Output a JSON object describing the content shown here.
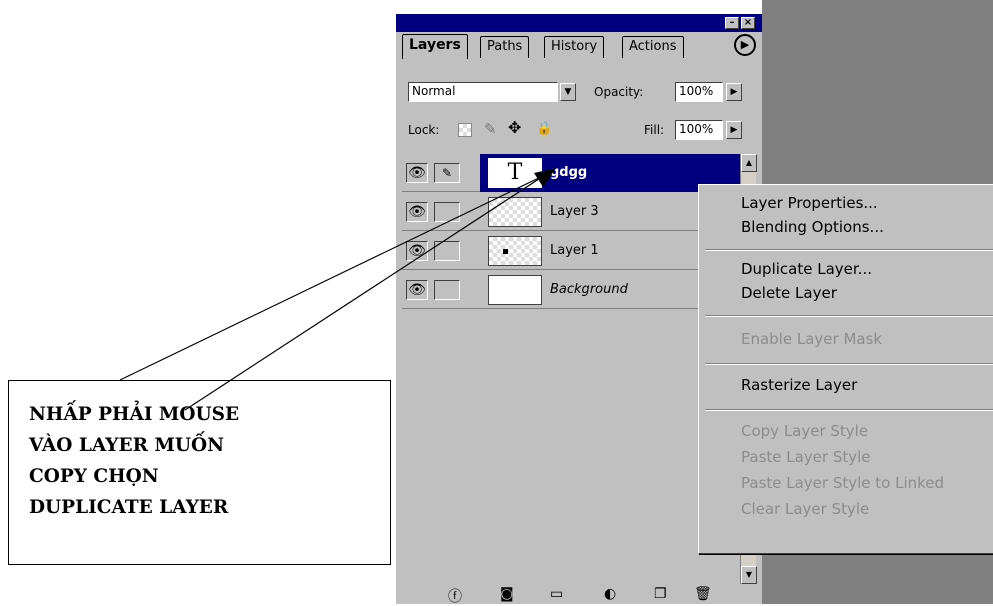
{
  "panel": {
    "tabs": [
      "Layers",
      "Paths",
      "History",
      "Actions"
    ],
    "blend_mode": "Normal",
    "opacity_label": "Opacity:",
    "opacity_value": "100%",
    "lock_label": "Lock:",
    "fill_label": "Fill:",
    "fill_value": "100%"
  },
  "layers": [
    {
      "name": "gdgg",
      "selected": true,
      "type": "text-layer",
      "thumb": "T"
    },
    {
      "name": "Layer 3",
      "selected": false,
      "type": "raster-layer"
    },
    {
      "name": "Layer 1",
      "selected": false,
      "type": "raster-layer"
    },
    {
      "name": "Background",
      "selected": false,
      "type": "background-layer"
    }
  ],
  "context_menu": {
    "items": [
      {
        "label": "Layer Properties...",
        "enabled": true
      },
      {
        "label": "Blending Options...",
        "enabled": true
      },
      {
        "label": "Duplicate Layer...",
        "enabled": true
      },
      {
        "label": "Delete Layer",
        "enabled": true
      },
      {
        "label": "Enable Layer Mask",
        "enabled": false
      },
      {
        "label": "Rasterize Layer",
        "enabled": true
      },
      {
        "label": "Copy Layer Style",
        "enabled": false
      },
      {
        "label": "Paste Layer Style",
        "enabled": false
      },
      {
        "label": "Paste Layer Style to Linked",
        "enabled": false
      },
      {
        "label": "Clear Layer Style",
        "enabled": false
      }
    ]
  },
  "callout": {
    "lines": [
      "NHẤP PHẢI MOUSE",
      "VÀO LAYER MUỐN",
      "COPY CHỌN",
      "DUPLICATE LAYER"
    ]
  },
  "colors": {
    "title_bar": "#000080",
    "selected_row": "#000080",
    "panel_bg": "#c0c0c0",
    "disabled_text": "#8c8c8c"
  },
  "icons": [
    "minimize-icon",
    "close-icon",
    "panel-menu-arrow-icon",
    "eye-icon",
    "brush-icon",
    "lock-transparency-icon",
    "lock-paint-icon",
    "lock-move-icon",
    "lock-all-icon",
    "layer-style-icon",
    "mask-icon",
    "folder-icon",
    "adjustment-layer-icon",
    "new-layer-icon",
    "trash-icon"
  ]
}
